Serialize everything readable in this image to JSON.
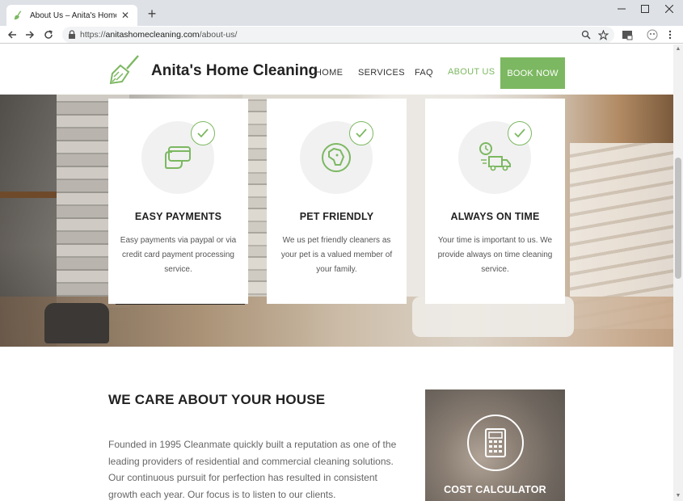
{
  "browser": {
    "tab_title": "About Us – Anita's Home Cleanin",
    "url_scheme": "https://",
    "url_host": "anitashomecleaning.com",
    "url_path": "/about-us/",
    "new_tab_label": "+",
    "tab_close_label": "✕"
  },
  "site": {
    "brand": "Anita's Home Cleaning",
    "nav": [
      "HOME",
      "SERVICES",
      "FAQ",
      "ABOUT US"
    ],
    "book_now": "BOOK NOW",
    "accent_color": "#7cb861"
  },
  "features": [
    {
      "title": "EASY PAYMENTS",
      "text": "Easy payments via paypal or via credit card payment processing service.",
      "icon": "credit-card-icon"
    },
    {
      "title": "PET FRIENDLY",
      "text": "We us pet friendly cleaners as your pet is a valued member of your family.",
      "icon": "pet-icon"
    },
    {
      "title": "ALWAYS ON TIME",
      "text": "Your time is important to us. We provide always on time cleaning service.",
      "icon": "delivery-truck-icon"
    }
  ],
  "about": {
    "title": "WE CARE ABOUT YOUR HOUSE",
    "text": "Founded in 1995 Cleanmate quickly built a reputation as one of the leading providers of residential and commercial cleaning solutions. Our continuous pursuit for perfection has resulted in consistent growth each year. Our focus is to listen to our clients."
  },
  "calculator": {
    "label": "COST CALCULATOR",
    "icon": "calculator-icon"
  }
}
